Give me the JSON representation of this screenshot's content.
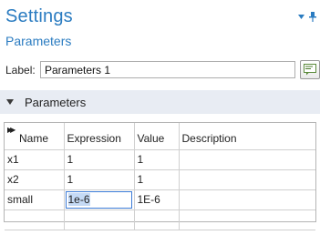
{
  "header": {
    "title": "Settings",
    "subtitle": "Parameters"
  },
  "label_field": {
    "label": "Label:",
    "value": "Parameters 1"
  },
  "section": {
    "title": "Parameters"
  },
  "table": {
    "columns": [
      "Name",
      "Expression",
      "Value",
      "Description"
    ],
    "rows": [
      {
        "name": "x1",
        "expression": "1",
        "value": "1",
        "description": ""
      },
      {
        "name": "x2",
        "expression": "1",
        "value": "1",
        "description": ""
      },
      {
        "name": "small",
        "expression": "1e-6",
        "value": "1E-6",
        "description": ""
      },
      {
        "name": "",
        "expression": "",
        "value": "",
        "description": ""
      }
    ]
  },
  "colors": {
    "accent": "#2b7cc1",
    "section_bg": "#e8ecf3",
    "selection": "#c5daf5"
  }
}
